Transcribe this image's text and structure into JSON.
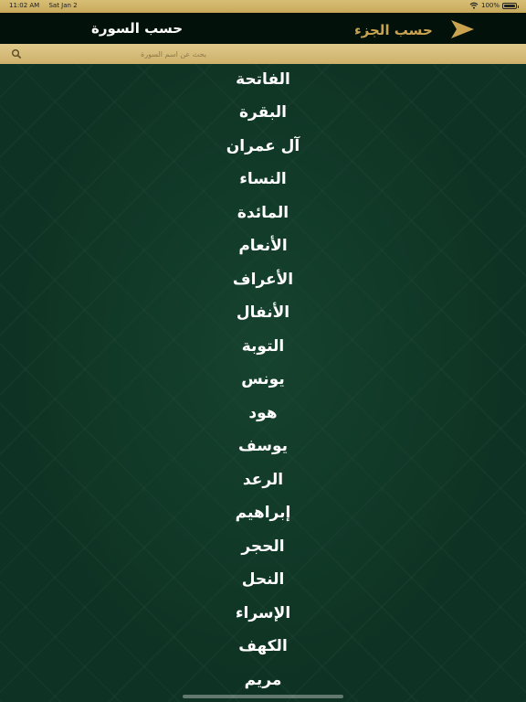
{
  "status_bar": {
    "time": "11:02 AM",
    "date": "Sat Jan 2",
    "battery": "100%",
    "battery_level": 1.0
  },
  "header": {
    "tab_surah": "حسب السورة",
    "tab_juz": "حسب الجزء"
  },
  "search": {
    "placeholder": "بحث عن اسم السورة",
    "value": ""
  },
  "surahs": [
    "الفاتحة",
    "البقرة",
    "آل عمران",
    "النساء",
    "المائدة",
    "الأنعام",
    "الأعراف",
    "الأنفال",
    "التوبة",
    "يونس",
    "هود",
    "يوسف",
    "الرعد",
    "إبراهيم",
    "الحجر",
    "النحل",
    "الإسراء",
    "الكهف",
    "مريم"
  ],
  "colors": {
    "gold": "#c9a34f",
    "header_bg": "#02120b",
    "list_bg": "#0e3223"
  }
}
